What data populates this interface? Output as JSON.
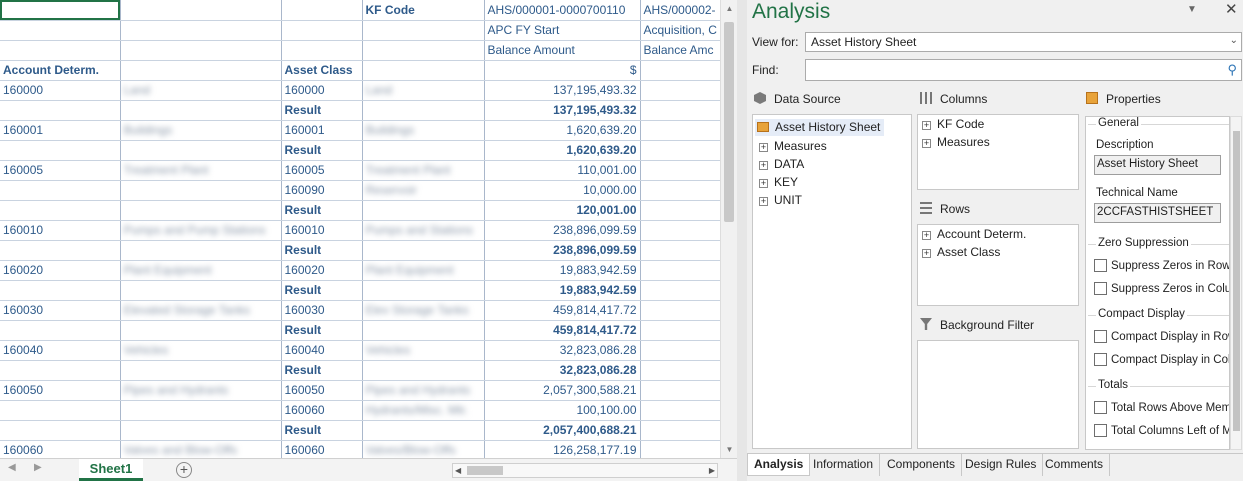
{
  "sheet": {
    "header_rows": [
      [
        "",
        "",
        "",
        "KF Code",
        "AHS/000001-0000700110",
        "AHS/000002-"
      ],
      [
        "",
        "",
        "",
        "",
        "APC FY Start",
        "Acquisition, C"
      ],
      [
        "",
        "",
        "",
        "",
        "Balance Amount",
        "Balance Amc"
      ],
      [
        "Account Determ.",
        "",
        "Asset Class",
        "",
        "$",
        ""
      ]
    ],
    "rows": [
      {
        "acct": "160000",
        "acct_txt": "Land",
        "cls": "160000",
        "cls_txt": "Land",
        "val": "137,195,493.32",
        "result": false
      },
      {
        "acct": "",
        "acct_txt": "",
        "cls": "Result",
        "cls_txt": "",
        "val": "137,195,493.32",
        "result": true
      },
      {
        "acct": "160001",
        "acct_txt": "Buildings",
        "cls": "160001",
        "cls_txt": "Buildings",
        "val": "1,620,639.20",
        "result": false
      },
      {
        "acct": "",
        "acct_txt": "",
        "cls": "Result",
        "cls_txt": "",
        "val": "1,620,639.20",
        "result": true
      },
      {
        "acct": "160005",
        "acct_txt": "Treatment Plant",
        "cls": "160005",
        "cls_txt": "Treatment Plant",
        "val": "110,001.00",
        "result": false
      },
      {
        "acct": "",
        "acct_txt": "",
        "cls": "160090",
        "cls_txt": "Reservoir",
        "val": "10,000.00",
        "result": false
      },
      {
        "acct": "",
        "acct_txt": "",
        "cls": "Result",
        "cls_txt": "",
        "val": "120,001.00",
        "result": true
      },
      {
        "acct": "160010",
        "acct_txt": "Pumps and Pump Stations",
        "cls": "160010",
        "cls_txt": "Pumps and Stations",
        "val": "238,896,099.59",
        "result": false
      },
      {
        "acct": "",
        "acct_txt": "",
        "cls": "Result",
        "cls_txt": "",
        "val": "238,896,099.59",
        "result": true
      },
      {
        "acct": "160020",
        "acct_txt": "Plant Equipment",
        "cls": "160020",
        "cls_txt": "Plant Equipment",
        "val": "19,883,942.59",
        "result": false
      },
      {
        "acct": "",
        "acct_txt": "",
        "cls": "Result",
        "cls_txt": "",
        "val": "19,883,942.59",
        "result": true
      },
      {
        "acct": "160030",
        "acct_txt": "Elevated Storage Tanks",
        "cls": "160030",
        "cls_txt": "Elev Storage Tanks",
        "val": "459,814,417.72",
        "result": false
      },
      {
        "acct": "",
        "acct_txt": "",
        "cls": "Result",
        "cls_txt": "",
        "val": "459,814,417.72",
        "result": true
      },
      {
        "acct": "160040",
        "acct_txt": "Vehicles",
        "cls": "160040",
        "cls_txt": "Vehicles",
        "val": "32,823,086.28",
        "result": false
      },
      {
        "acct": "",
        "acct_txt": "",
        "cls": "Result",
        "cls_txt": "",
        "val": "32,823,086.28",
        "result": true
      },
      {
        "acct": "160050",
        "acct_txt": "Pipes and Hydrants",
        "cls": "160050",
        "cls_txt": "Pipes and Hydrants",
        "val": "2,057,300,588.21",
        "result": false
      },
      {
        "acct": "",
        "acct_txt": "",
        "cls": "160060",
        "cls_txt": "Hydrants/Misc. Mtr.",
        "val": "100,100.00",
        "result": false
      },
      {
        "acct": "",
        "acct_txt": "",
        "cls": "Result",
        "cls_txt": "",
        "val": "2,057,400,688.21",
        "result": true
      },
      {
        "acct": "160060",
        "acct_txt": "Valves and Blow-Offs",
        "cls": "160060",
        "cls_txt": "Valves/Blow-Offs",
        "val": "126,258,177.19",
        "result": false
      }
    ],
    "tab_label": "Sheet1",
    "add_label": "+"
  },
  "pane": {
    "title": "Analysis",
    "view_for_label": "View for:",
    "view_for_value": "Asset History Sheet",
    "find_label": "Find:",
    "find_value": "",
    "data_source": {
      "title": "Data Source",
      "root": "Asset History Sheet",
      "items": [
        "Measures",
        "DATA",
        "KEY",
        "UNIT"
      ]
    },
    "columns": {
      "title": "Columns",
      "items": [
        "KF Code",
        "Measures"
      ]
    },
    "rows": {
      "title": "Rows",
      "items": [
        "Account Determ.",
        "Asset Class"
      ]
    },
    "background_filter": {
      "title": "Background Filter"
    },
    "properties": {
      "title": "Properties",
      "general": {
        "title": "General",
        "description_label": "Description",
        "description_value": "Asset History Sheet",
        "technical_label": "Technical Name",
        "technical_value": "2CCFASTHISTSHEET"
      },
      "zero": {
        "title": "Zero Suppression",
        "items": [
          "Suppress Zeros in Rows",
          "Suppress Zeros in Colur"
        ]
      },
      "compact": {
        "title": "Compact Display",
        "items": [
          "Compact Display in Row",
          "Compact Display in Col"
        ]
      },
      "totals": {
        "title": "Totals",
        "items": [
          "Total Rows Above Mem",
          "Total Columns Left of M"
        ]
      }
    },
    "tabs": [
      "Analysis",
      "Information",
      "Components",
      "Design Rules",
      "Comments"
    ]
  },
  "colors": {
    "accent": "#217346",
    "cell_text": "#2e5a8a",
    "header_bg": "#dce6f1"
  }
}
